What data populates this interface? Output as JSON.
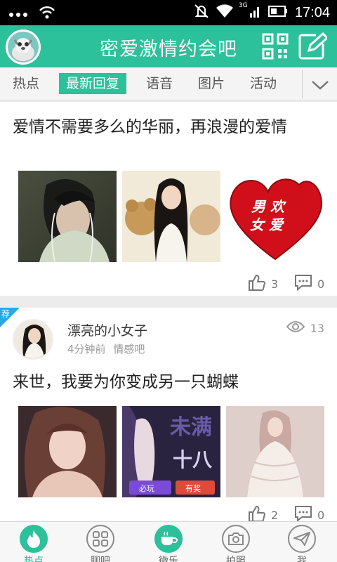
{
  "status_bar": {
    "time": "17:04",
    "network_label": "3G"
  },
  "header": {
    "title": "密爱激情约会吧"
  },
  "tabs": [
    {
      "label": "热点"
    },
    {
      "label": "最新回复"
    },
    {
      "label": "语音"
    },
    {
      "label": "图片"
    },
    {
      "label": "活动"
    }
  ],
  "posts": [
    {
      "title": "爱情不需要多么的华丽，再浪漫的爱情",
      "like_count": "3",
      "comment_count": "0",
      "image3_text_line1": "男 欢",
      "image3_text_line2": "女 爱"
    },
    {
      "badge": "荐",
      "author": "漂亮的小女子",
      "time": "4分钟前",
      "forum": "情感吧",
      "views": "13",
      "title": "来世，我要为你变成另一只蝴蝶",
      "like_count": "2",
      "comment_count": "0",
      "image2_text_big": "未满",
      "image2_text_sub": "十八",
      "image2_btn1": "必玩",
      "image2_btn2": "有奖"
    }
  ],
  "bottom_nav": [
    {
      "label": "热点"
    },
    {
      "label": "聊吧"
    },
    {
      "label": "微乐"
    },
    {
      "label": "拍照"
    },
    {
      "label": "我"
    }
  ],
  "colors": {
    "accent": "#2cc09b",
    "badge": "#2aa9e0"
  }
}
